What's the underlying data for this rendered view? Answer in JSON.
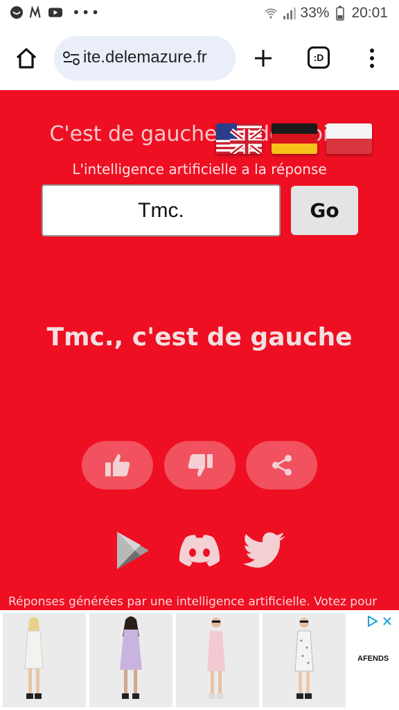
{
  "status_bar": {
    "battery": "33%",
    "time": "20:01",
    "more": "•••"
  },
  "browser": {
    "url": "ite.delemazure.fr",
    "tab_count": ":D"
  },
  "page": {
    "headline": "C'est de gauche ou de droite",
    "subtitle": "L'intelligence artificielle a la réponse",
    "search_value": "Tmc.",
    "go_label": "Go",
    "result": "Tmc., c'est de gauche",
    "disclaimer": "Réponses générées par une intelligence artificielle. Votez pour"
  },
  "flags": [
    "us-flag",
    "german-flag",
    "polish-flag"
  ],
  "ad": {
    "brand": "AFENDS",
    "dress_colors": [
      "#f2f2ee",
      "#c9b4e0",
      "#f3c9d2",
      "#f4f4f4"
    ]
  },
  "colors": {
    "brand_red": "#ee0f22"
  }
}
